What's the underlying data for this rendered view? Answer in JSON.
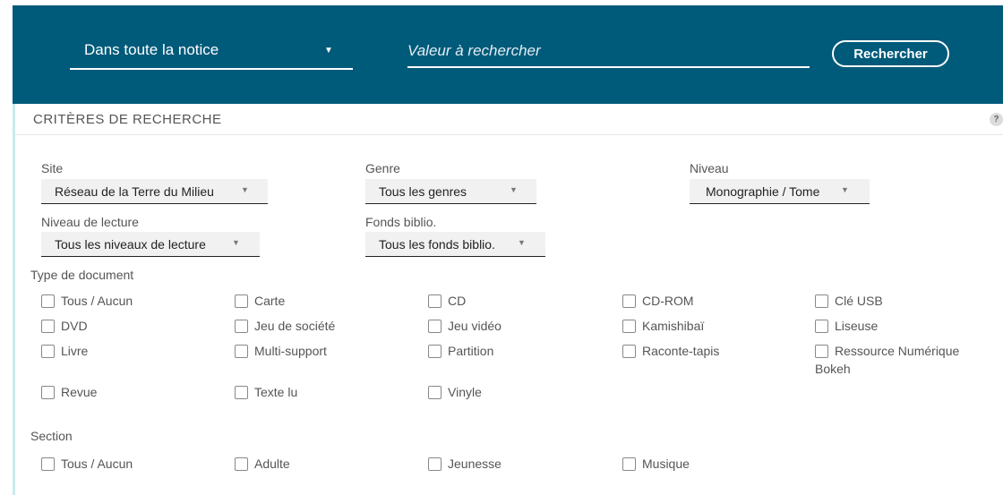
{
  "search": {
    "scope_value": "Dans toute la notice",
    "query_placeholder": "Valeur à rechercher",
    "query_value": "",
    "submit_label": "Rechercher"
  },
  "criteria": {
    "title": "CRITÈRES DE RECHERCHE",
    "help_label": "?",
    "site": {
      "label": "Site",
      "value": "Réseau de la Terre du Milieu"
    },
    "genre": {
      "label": "Genre",
      "value": "Tous les genres"
    },
    "niveau": {
      "label": "Niveau",
      "value": "Monographie / Tome"
    },
    "niveau_lecture": {
      "label": "Niveau de lecture",
      "value": "Tous les niveaux de lecture"
    },
    "fonds": {
      "label": "Fonds biblio.",
      "value": "Tous les fonds biblio."
    },
    "type_document": {
      "label": "Type de document",
      "options": [
        "Tous / Aucun",
        "Carte",
        "CD",
        "CD-ROM",
        "Clé USB",
        "DVD",
        "Jeu de société",
        "Jeu vidéo",
        "Kamishibaï",
        "Liseuse",
        "Livre",
        "Multi-support",
        "Partition",
        "Raconte-tapis",
        "Ressource Numérique Bokeh",
        "Revue",
        "Texte lu",
        "Vinyle"
      ]
    },
    "section": {
      "label": "Section",
      "options": [
        "Tous / Aucun",
        "Adulte",
        "Jeunesse",
        "Musique"
      ]
    }
  },
  "colors": {
    "header_bg": "#005a7a",
    "accent": "#c8ecec"
  }
}
